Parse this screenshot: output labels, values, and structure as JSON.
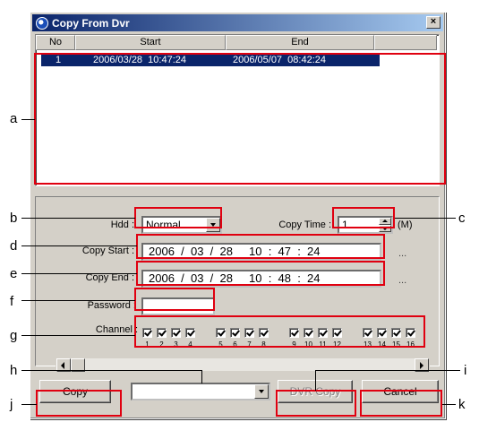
{
  "window": {
    "title": "Copy From Dvr",
    "close_glyph": "×"
  },
  "list": {
    "columns": [
      "No",
      "Start",
      "End"
    ],
    "rows": [
      {
        "no": "1",
        "start": "2006/03/28  10:47:24",
        "end": "2006/05/07  08:42:24"
      }
    ]
  },
  "form": {
    "hdd_label": "Hdd :",
    "hdd_value": "Normal",
    "copy_time_label": "Copy Time :",
    "copy_time_value": "1",
    "copy_time_unit": "(M)",
    "copy_start_label": "Copy Start :",
    "copy_start_value": "2006  /  03  /  28     10  :  47  :  24",
    "copy_end_label": "Copy End :",
    "copy_end_value": "2006  /  03  /  28     10  :  48  :  24",
    "ellipsis": "...",
    "password_label": "Password :",
    "password_value": "",
    "channel_label": "Channel :",
    "channels": [
      "1",
      "2",
      "3",
      "4",
      "5",
      "6",
      "7",
      "8",
      "9",
      "10",
      "11",
      "12",
      "13",
      "14",
      "15",
      "16"
    ]
  },
  "buttons": {
    "copy": "Copy",
    "dvr_copy": "DVR Copy",
    "cancel": "Cancel",
    "device_select_value": ""
  },
  "callouts": {
    "a": "a",
    "b": "b",
    "c": "c",
    "d": "d",
    "e": "e",
    "f": "f",
    "g": "g",
    "h": "h",
    "i": "i",
    "j": "j",
    "k": "k"
  },
  "colors": {
    "highlight_box": "#e00010",
    "selection": "#0a246a",
    "title_bar": "#0a246a"
  }
}
